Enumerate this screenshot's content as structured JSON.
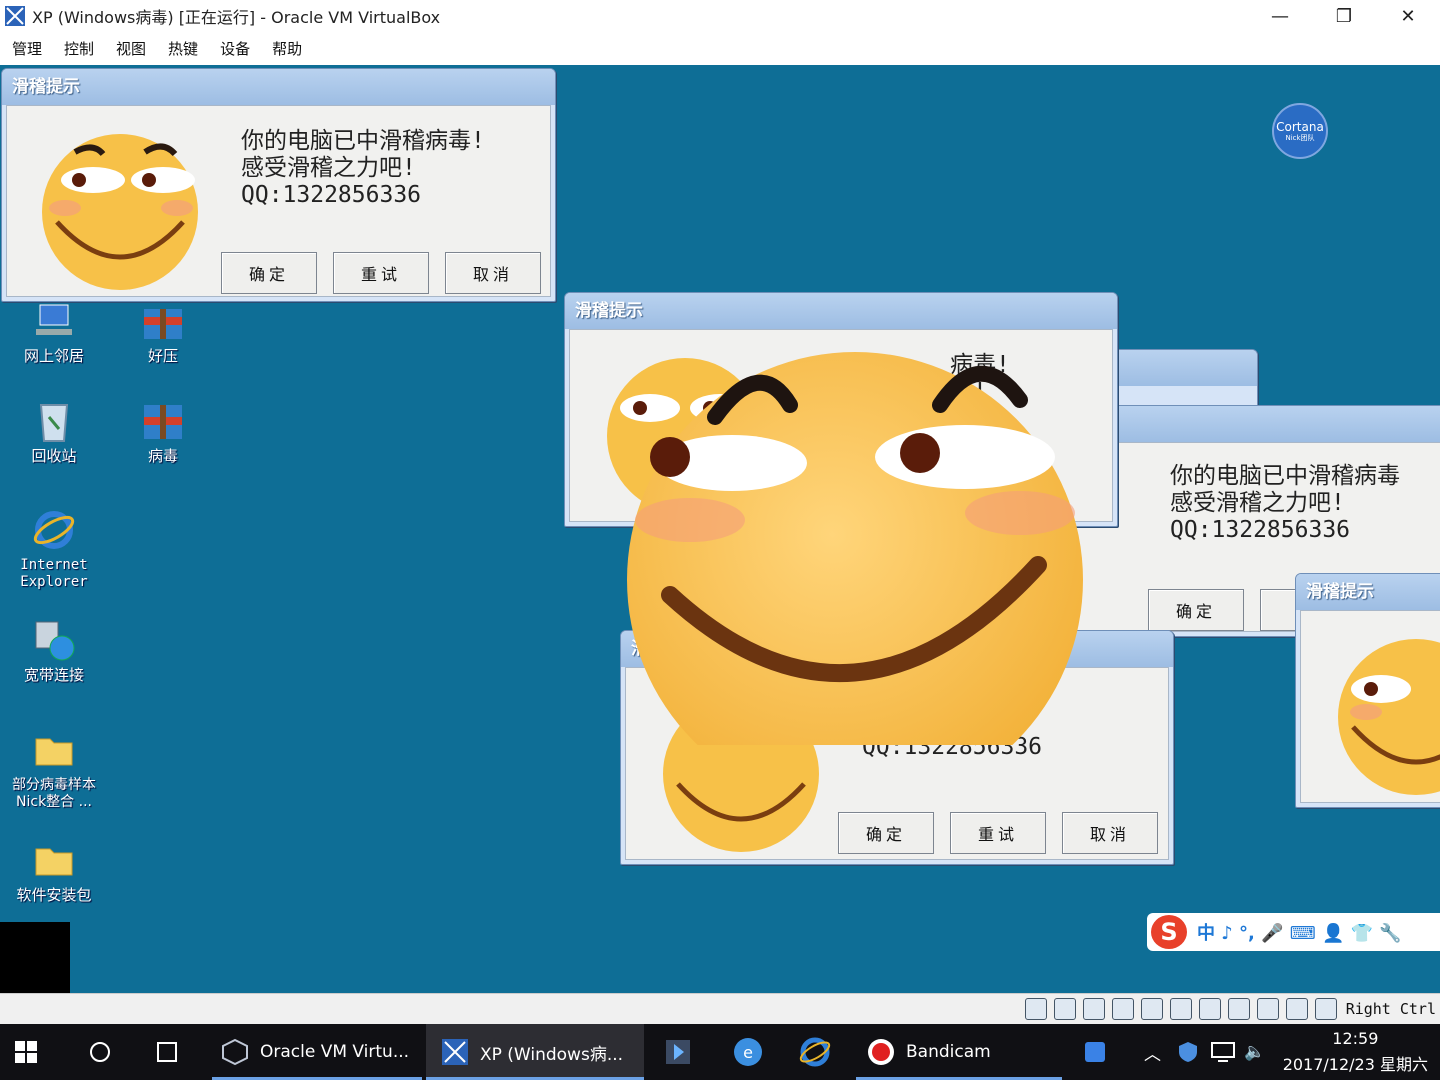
{
  "host_window": {
    "title": "XP (Windows病毒) [正在运行] - Oracle VM VirtualBox",
    "menu": [
      "管理",
      "控制",
      "视图",
      "热键",
      "设备",
      "帮助"
    ]
  },
  "cortana": {
    "label": "Cortana",
    "sub": "Nick团队"
  },
  "desktop_icons": [
    {
      "label": "网上邻居",
      "icon": "network-icon"
    },
    {
      "label": "好压",
      "icon": "archive-icon"
    },
    {
      "label": "回收站",
      "icon": "recycle-bin-icon"
    },
    {
      "label": "病毒",
      "icon": "archive-icon"
    },
    {
      "label": "Internet\nExplorer",
      "icon": "ie-icon"
    },
    {
      "label": "宽带连接",
      "icon": "broadband-icon"
    },
    {
      "label": "部分病毒样本\nNick整合  ...",
      "icon": "folder-icon"
    },
    {
      "label": "软件安装包",
      "icon": "folder-icon"
    }
  ],
  "dialog": {
    "title": "滑稽提示",
    "message": "你的电脑已中滑稽病毒!\n感受滑稽之力吧!\nQQ:1322856336",
    "message_right": "你的电脑已中滑稽病毒\n感受滑稽之力吧!\nQQ:1322856336",
    "message_partial_1": "病毒!\n吧!",
    "message_partial_2": "稽病毒!\n吧!\nQQ:1322856336",
    "ok": "确定",
    "retry": "重试",
    "retry_partial": "重",
    "cancel": "取消",
    "title_partial": "滑"
  },
  "ime": {
    "logo": "S",
    "items": "中 ♪ °, 🎤 ⌨ 👤 👕 🔧"
  },
  "vbox_status": {
    "host_key": "Right Ctrl"
  },
  "taskbar": {
    "items": [
      "Oracle VM Virtu...",
      "XP (Windows病...",
      "Bandicam"
    ],
    "time": "12:59",
    "date": "2017/12/23 星期六"
  },
  "colors": {
    "desktop": "#0e6e96",
    "dialog_title": "#9dbde3",
    "face": "#f7c148"
  }
}
